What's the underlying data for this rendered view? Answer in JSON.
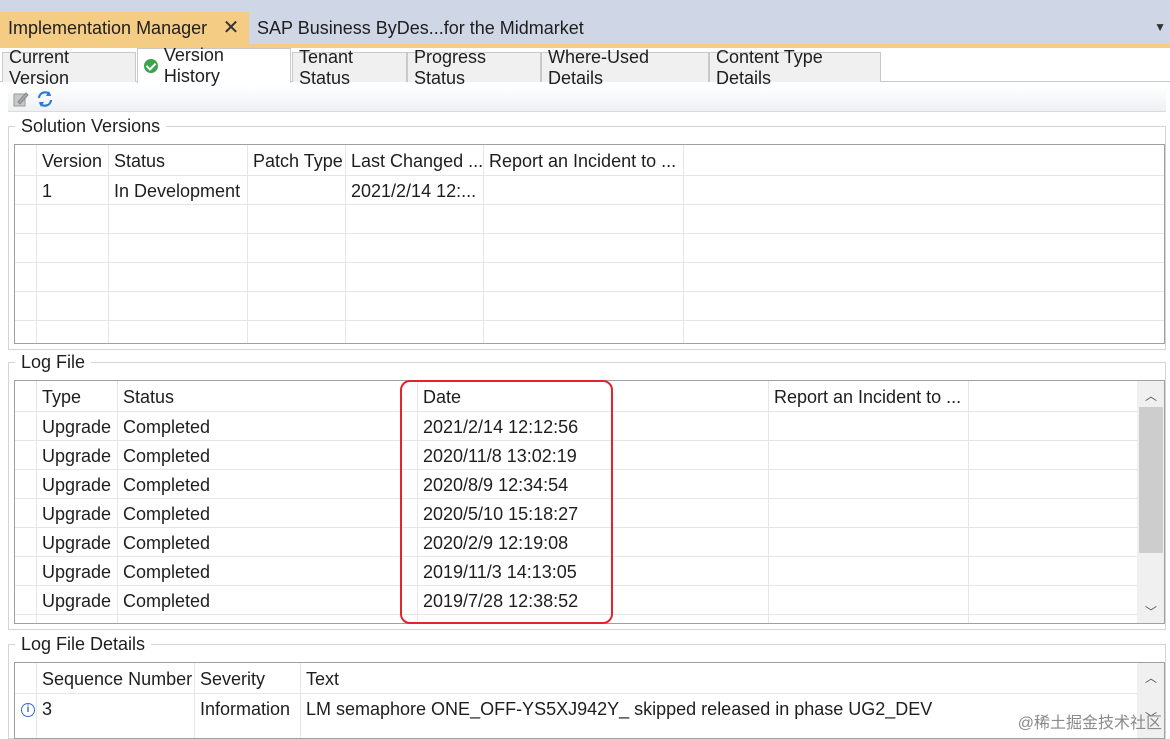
{
  "doc_tabs": {
    "active_label": "Implementation Manager",
    "inactive_label": "SAP Business ByDes...for the Midmarket"
  },
  "inner_tabs": [
    {
      "label": "Current Version"
    },
    {
      "label": "Version History"
    },
    {
      "label": "Tenant Status"
    },
    {
      "label": "Progress Status"
    },
    {
      "label": "Where-Used Details"
    },
    {
      "label": "Content Type Details"
    }
  ],
  "toolbar": {
    "icons": [
      "edit-icon",
      "refresh-icon"
    ]
  },
  "solution_versions": {
    "title": "Solution Versions",
    "columns": [
      "Version",
      "Status",
      "Patch Type",
      "Last Changed ...",
      "Report an Incident to ..."
    ],
    "rows": [
      [
        "1",
        "In Development",
        "",
        "2021/2/14 12:...",
        ""
      ]
    ]
  },
  "log_file": {
    "title": "Log File",
    "columns": [
      "Type",
      "Status",
      "Date",
      "Report an Incident to ..."
    ],
    "rows": [
      [
        "Upgrade",
        "Completed",
        "2021/2/14 12:12:56",
        ""
      ],
      [
        "Upgrade",
        "Completed",
        "2020/11/8 13:02:19",
        ""
      ],
      [
        "Upgrade",
        "Completed",
        "2020/8/9 12:34:54",
        ""
      ],
      [
        "Upgrade",
        "Completed",
        "2020/5/10 15:18:27",
        ""
      ],
      [
        "Upgrade",
        "Completed",
        "2020/2/9 12:19:08",
        ""
      ],
      [
        "Upgrade",
        "Completed",
        "2019/11/3 14:13:05",
        ""
      ],
      [
        "Upgrade",
        "Completed",
        "2019/7/28 12:38:52",
        ""
      ]
    ]
  },
  "log_file_details": {
    "title": "Log File Details",
    "columns": [
      "Sequence Number",
      "Severity",
      "Text"
    ],
    "rows": [
      [
        "3",
        "Information",
        "LM semaphore ONE_OFF-YS5XJ942Y_ skipped released in phase UG2_DEV"
      ]
    ]
  },
  "watermark": "@稀土掘金技术社区",
  "colors": {
    "active_tab": "#f5cc84",
    "tab_bar": "#cfd6e5",
    "highlight": "#e0262b"
  }
}
